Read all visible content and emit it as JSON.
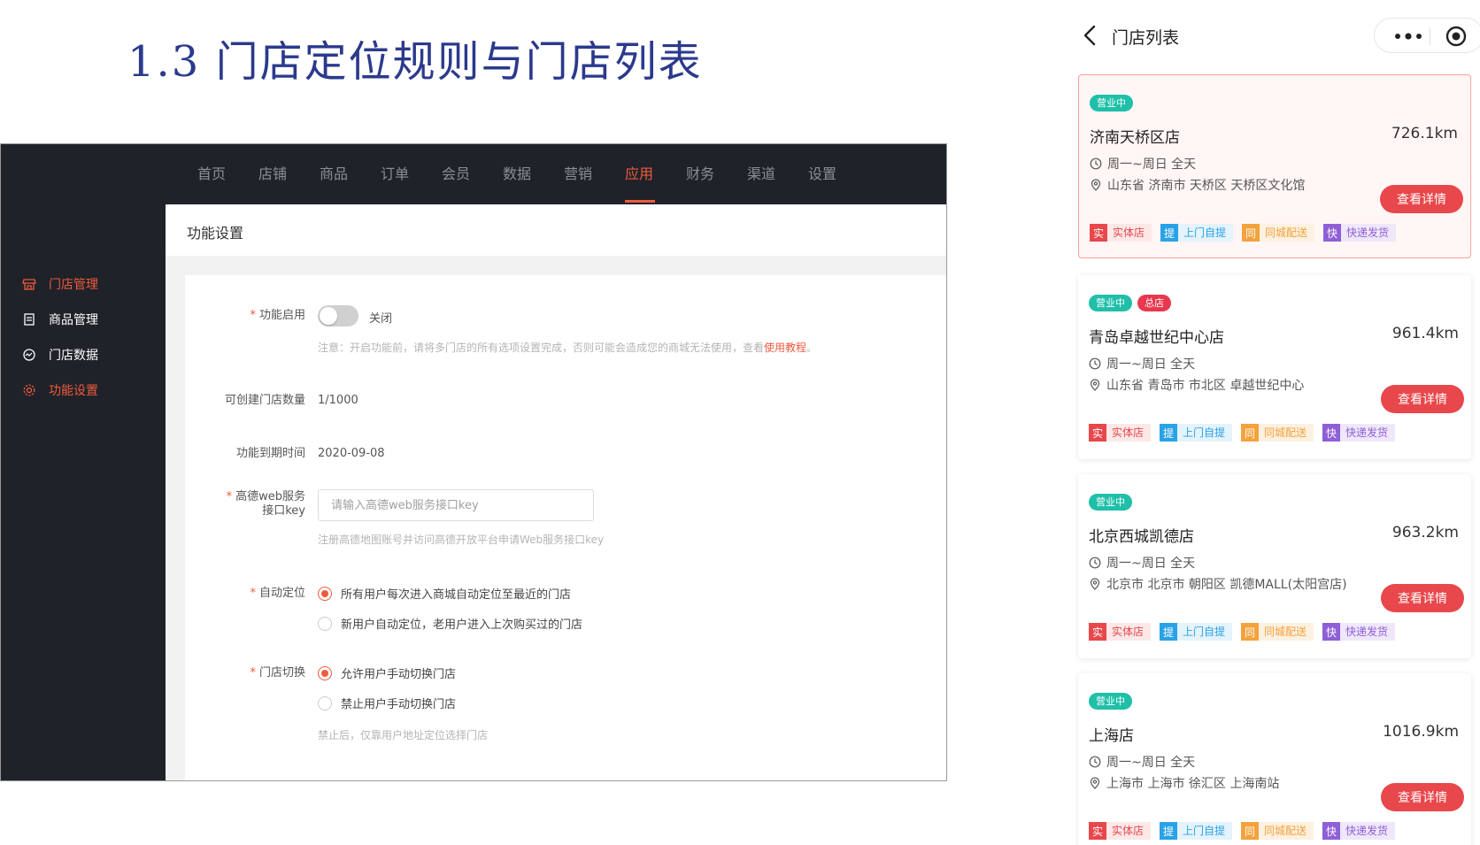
{
  "slide": {
    "title": "1.3 门店定位规则与门店列表"
  },
  "admin": {
    "nav": [
      "首页",
      "店铺",
      "商品",
      "订单",
      "会员",
      "数据",
      "营销",
      "应用",
      "财务",
      "渠道",
      "设置"
    ],
    "nav_active": "应用",
    "sidebar": [
      {
        "label": "门店管理",
        "icon": "store-icon",
        "active": true
      },
      {
        "label": "商品管理",
        "icon": "document-icon",
        "active": false
      },
      {
        "label": "门店数据",
        "icon": "chart-icon",
        "active": false
      },
      {
        "label": "功能设置",
        "icon": "gear-icon",
        "active": true
      }
    ],
    "page_header": "功能设置",
    "form": {
      "enable": {
        "label": "功能启用",
        "state_label": "关闭",
        "on": false,
        "note": "注意：开启功能前，请将多门店的所有选项设置完成，否则可能会造成您的商城无法使用，查看",
        "note_link": "使用教程",
        "note_end": "。"
      },
      "store_count": {
        "label": "可创建门店数量",
        "value": "1/1000"
      },
      "expire": {
        "label": "功能到期时间",
        "value": "2020-09-08"
      },
      "amap_key": {
        "label_line1": "高德web服务",
        "label_line2": "接口key",
        "placeholder": "请输入高德web服务接口key",
        "value": "",
        "note": "注册高德地图账号并访问高德开放平台申请Web服务接口key"
      },
      "auto_locate": {
        "label": "自动定位",
        "options": [
          {
            "label": "所有用户每次进入商城自动定位至最近的门店",
            "checked": true
          },
          {
            "label": "新用户自动定位，老用户进入上次购买过的门店",
            "checked": false
          }
        ]
      },
      "switch_store": {
        "label": "门店切换",
        "options": [
          {
            "label": "允许用户手动切换门店",
            "checked": true
          },
          {
            "label": "禁止用户手动切换门店",
            "checked": false
          }
        ],
        "note": "禁止后，仅靠用户地址定位选择门店"
      }
    }
  },
  "mobile": {
    "title": "门店列表",
    "detail_label": "查看详情",
    "tags": [
      {
        "icon": "实",
        "label": "实体店"
      },
      {
        "icon": "提",
        "label": "上门自提"
      },
      {
        "icon": "同",
        "label": "同城配送"
      },
      {
        "icon": "快",
        "label": "快递发货"
      }
    ],
    "stores": [
      {
        "badge": "营业中",
        "hq_badge": "",
        "name": "济南天桥区店",
        "distance": "726.1km",
        "hours": "周一~周日 全天",
        "address": "山东省 济南市 天桥区 天桥区文化馆",
        "selected": true
      },
      {
        "badge": "营业中",
        "hq_badge": "总店",
        "name": "青岛卓越世纪中心店",
        "distance": "961.4km",
        "hours": "周一~周日 全天",
        "address": "山东省 青岛市 市北区 卓越世纪中心",
        "selected": false
      },
      {
        "badge": "营业中",
        "hq_badge": "",
        "name": "北京西城凯德店",
        "distance": "963.2km",
        "hours": "周一~周日 全天",
        "address": "北京市 北京市 朝阳区 凯德MALL(太阳宫店)",
        "selected": false
      },
      {
        "badge": "营业中",
        "hq_badge": "",
        "name": "上海店",
        "distance": "1016.9km",
        "hours": "周一~周日 全天",
        "address": "上海市 上海市 徐汇区 上海南站",
        "selected": false
      }
    ],
    "colors": {
      "accent": "#e8474b",
      "open": "#1fbfa8"
    }
  }
}
